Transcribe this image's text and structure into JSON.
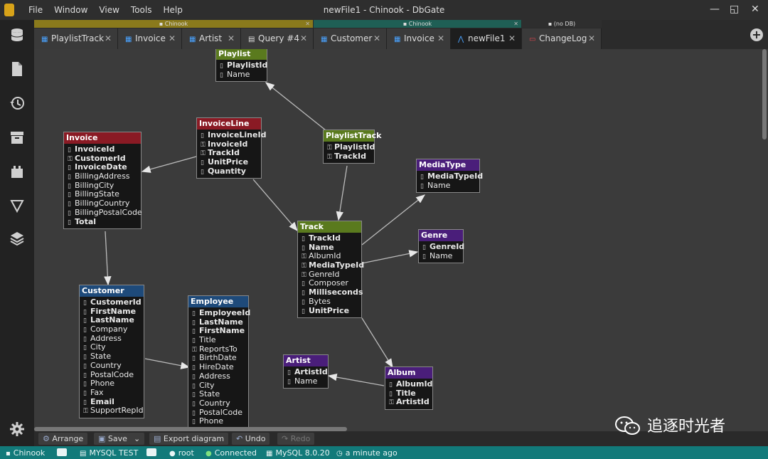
{
  "titlebar": {
    "menus": [
      "File",
      "Window",
      "View",
      "Tools",
      "Help"
    ],
    "title": "newFile1 - Chinook - DbGate",
    "controls": [
      "—",
      "◱",
      "✕"
    ]
  },
  "sidebar": {
    "icons": [
      "database-icon",
      "file-icon",
      "history-icon",
      "archive-icon",
      "plugin-icon",
      "filter-icon",
      "layers-icon",
      "settings-icon"
    ]
  },
  "tab_groups": [
    {
      "label": "Chinook",
      "color": "#8a7a1c"
    },
    {
      "label": "Chinook",
      "color": "#1f5f55"
    },
    {
      "label": "(no DB)",
      "color": "#2e2e2e"
    }
  ],
  "tabs": [
    {
      "label": "PlaylistTrack",
      "icon": "table-icon",
      "icon_color": "#4aa3ff",
      "active": false
    },
    {
      "label": "Invoice",
      "icon": "table-icon",
      "icon_color": "#4aa3ff",
      "active": false
    },
    {
      "label": "Artist",
      "icon": "table-icon",
      "icon_color": "#4aa3ff",
      "active": false
    },
    {
      "label": "Query #4",
      "icon": "file-icon",
      "icon_color": "#dddddd",
      "active": false
    },
    {
      "label": "Customer",
      "icon": "table-icon",
      "icon_color": "#4aa3ff",
      "active": false
    },
    {
      "label": "Invoice",
      "icon": "table-icon",
      "icon_color": "#4aa3ff",
      "active": false
    },
    {
      "label": "newFile1",
      "icon": "diagram-icon",
      "icon_color": "#4aa3ff",
      "active": true
    },
    {
      "label": "ChangeLog",
      "icon": "table-icon",
      "icon_color": "#e0464f",
      "active": false
    }
  ],
  "tables": {
    "playlist": {
      "name": "Playlist",
      "color": "#5a7a1e",
      "columns": [
        {
          "name": "PlaylistId",
          "bold": true,
          "icon": "pk"
        },
        {
          "name": "Name",
          "bold": false,
          "icon": "col"
        }
      ]
    },
    "invoiceline": {
      "name": "InvoiceLine",
      "color": "#8a1a24",
      "columns": [
        {
          "name": "InvoiceLineId",
          "bold": true,
          "icon": "pk"
        },
        {
          "name": "InvoiceId",
          "bold": true,
          "icon": "fk"
        },
        {
          "name": "TrackId",
          "bold": true,
          "icon": "fk"
        },
        {
          "name": "UnitPrice",
          "bold": true,
          "icon": "col"
        },
        {
          "name": "Quantity",
          "bold": true,
          "icon": "col"
        }
      ]
    },
    "playlisttrack": {
      "name": "PlaylistTrack",
      "color": "#5a7a1e",
      "columns": [
        {
          "name": "PlaylistId",
          "bold": true,
          "icon": "fk"
        },
        {
          "name": "TrackId",
          "bold": true,
          "icon": "fk"
        }
      ]
    },
    "invoice": {
      "name": "Invoice",
      "color": "#8a1a24",
      "columns": [
        {
          "name": "InvoiceId",
          "bold": true,
          "icon": "pk"
        },
        {
          "name": "CustomerId",
          "bold": true,
          "icon": "fk"
        },
        {
          "name": "InvoiceDate",
          "bold": true,
          "icon": "col"
        },
        {
          "name": "BillingAddress",
          "bold": false,
          "icon": "col"
        },
        {
          "name": "BillingCity",
          "bold": false,
          "icon": "col"
        },
        {
          "name": "BillingState",
          "bold": false,
          "icon": "col"
        },
        {
          "name": "BillingCountry",
          "bold": false,
          "icon": "col"
        },
        {
          "name": "BillingPostalCode",
          "bold": false,
          "icon": "col"
        },
        {
          "name": "Total",
          "bold": true,
          "icon": "col"
        }
      ]
    },
    "mediatype": {
      "name": "MediaType",
      "color": "#4a1e7a",
      "columns": [
        {
          "name": "MediaTypeId",
          "bold": true,
          "icon": "pk"
        },
        {
          "name": "Name",
          "bold": false,
          "icon": "col"
        }
      ]
    },
    "genre": {
      "name": "Genre",
      "color": "#4a1e7a",
      "columns": [
        {
          "name": "GenreId",
          "bold": true,
          "icon": "pk"
        },
        {
          "name": "Name",
          "bold": false,
          "icon": "col"
        }
      ]
    },
    "track": {
      "name": "Track",
      "color": "#5a7a1e",
      "columns": [
        {
          "name": "TrackId",
          "bold": true,
          "icon": "pk"
        },
        {
          "name": "Name",
          "bold": true,
          "icon": "col"
        },
        {
          "name": "AlbumId",
          "bold": false,
          "icon": "fk"
        },
        {
          "name": "MediaTypeId",
          "bold": true,
          "icon": "fk"
        },
        {
          "name": "GenreId",
          "bold": false,
          "icon": "fk"
        },
        {
          "name": "Composer",
          "bold": false,
          "icon": "col"
        },
        {
          "name": "Milliseconds",
          "bold": true,
          "icon": "col"
        },
        {
          "name": "Bytes",
          "bold": false,
          "icon": "col"
        },
        {
          "name": "UnitPrice",
          "bold": true,
          "icon": "col"
        }
      ]
    },
    "customer": {
      "name": "Customer",
      "color": "#1e4a7a",
      "columns": [
        {
          "name": "CustomerId",
          "bold": true,
          "icon": "pk"
        },
        {
          "name": "FirstName",
          "bold": true,
          "icon": "col"
        },
        {
          "name": "LastName",
          "bold": true,
          "icon": "col"
        },
        {
          "name": "Company",
          "bold": false,
          "icon": "col"
        },
        {
          "name": "Address",
          "bold": false,
          "icon": "col"
        },
        {
          "name": "City",
          "bold": false,
          "icon": "col"
        },
        {
          "name": "State",
          "bold": false,
          "icon": "col"
        },
        {
          "name": "Country",
          "bold": false,
          "icon": "col"
        },
        {
          "name": "PostalCode",
          "bold": false,
          "icon": "col"
        },
        {
          "name": "Phone",
          "bold": false,
          "icon": "col"
        },
        {
          "name": "Fax",
          "bold": false,
          "icon": "col"
        },
        {
          "name": "Email",
          "bold": true,
          "icon": "col"
        },
        {
          "name": "SupportRepId",
          "bold": false,
          "icon": "fk"
        }
      ]
    },
    "employee": {
      "name": "Employee",
      "color": "#1e4a7a",
      "columns": [
        {
          "name": "EmployeeId",
          "bold": true,
          "icon": "pk"
        },
        {
          "name": "LastName",
          "bold": true,
          "icon": "col"
        },
        {
          "name": "FirstName",
          "bold": true,
          "icon": "col"
        },
        {
          "name": "Title",
          "bold": false,
          "icon": "col"
        },
        {
          "name": "ReportsTo",
          "bold": false,
          "icon": "fk"
        },
        {
          "name": "BirthDate",
          "bold": false,
          "icon": "col"
        },
        {
          "name": "HireDate",
          "bold": false,
          "icon": "col"
        },
        {
          "name": "Address",
          "bold": false,
          "icon": "col"
        },
        {
          "name": "City",
          "bold": false,
          "icon": "col"
        },
        {
          "name": "State",
          "bold": false,
          "icon": "col"
        },
        {
          "name": "Country",
          "bold": false,
          "icon": "col"
        },
        {
          "name": "PostalCode",
          "bold": false,
          "icon": "col"
        },
        {
          "name": "Phone",
          "bold": false,
          "icon": "col"
        }
      ]
    },
    "artist": {
      "name": "Artist",
      "color": "#4a1e7a",
      "columns": [
        {
          "name": "ArtistId",
          "bold": true,
          "icon": "pk"
        },
        {
          "name": "Name",
          "bold": false,
          "icon": "col"
        }
      ]
    },
    "album": {
      "name": "Album",
      "color": "#4a1e7a",
      "columns": [
        {
          "name": "AlbumId",
          "bold": true,
          "icon": "pk"
        },
        {
          "name": "Title",
          "bold": true,
          "icon": "col"
        },
        {
          "name": "ArtistId",
          "bold": true,
          "icon": "fk"
        }
      ]
    }
  },
  "relations": [
    [
      "playlisttrack",
      "playlist"
    ],
    [
      "playlisttrack",
      "track"
    ],
    [
      "invoiceline",
      "invoice"
    ],
    [
      "invoiceline",
      "track"
    ],
    [
      "invoice",
      "customer"
    ],
    [
      "customer",
      "employee"
    ],
    [
      "track",
      "mediatype"
    ],
    [
      "track",
      "genre"
    ],
    [
      "track",
      "album"
    ],
    [
      "album",
      "artist"
    ]
  ],
  "toolbar": {
    "arrange": "Arrange",
    "save": "Save",
    "save_more": "⌄",
    "export": "Export diagram",
    "undo": "Undo",
    "redo": "Redo"
  },
  "watermark": "追逐时光者",
  "statusbar": {
    "database": "Chinook",
    "connection": "MYSQL TEST",
    "user": "root",
    "state": "Connected",
    "server": "MySQL 8.0.20",
    "time": "a minute ago"
  }
}
